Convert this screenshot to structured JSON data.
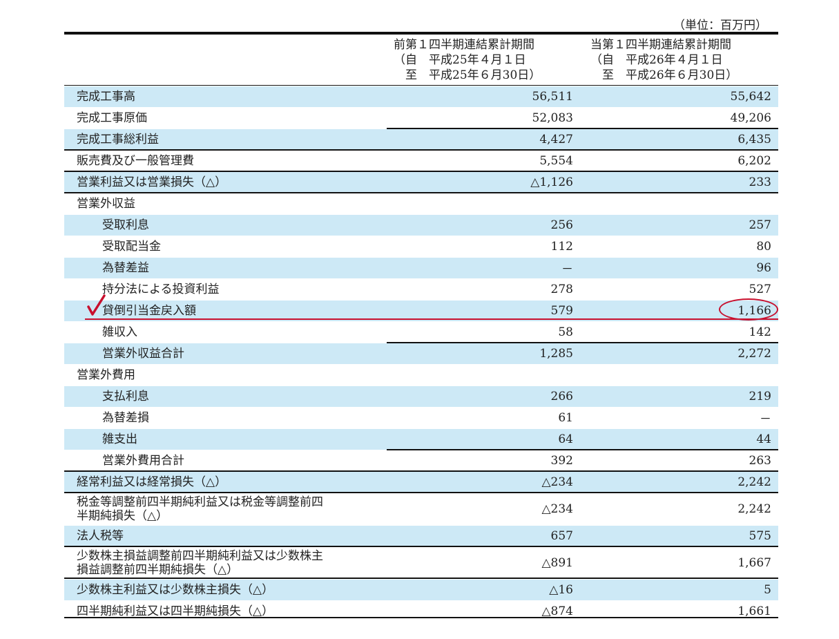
{
  "unit_label": "（単位：百万円）",
  "columns": {
    "prev": "前第１四半期連結累計期間\n（自　平成25年４月１日\n　至　平成25年６月30日）",
    "curr": "当第１四半期連結累計期間\n（自　平成26年４月１日\n　至　平成26年６月30日）"
  },
  "rows": [
    {
      "label": "完成工事高",
      "prev": "56,511",
      "curr": "55,642"
    },
    {
      "label": "完成工事原価",
      "prev": "52,083",
      "curr": "49,206"
    },
    {
      "label": "完成工事総利益",
      "prev": "4,427",
      "curr": "6,435"
    },
    {
      "label": "販売費及び一般管理費",
      "prev": "5,554",
      "curr": "6,202"
    },
    {
      "label": "営業利益又は営業損失（△）",
      "prev": "△1,126",
      "curr": "233"
    },
    {
      "label": "営業外収益",
      "prev": "",
      "curr": ""
    },
    {
      "label": "受取利息",
      "prev": "256",
      "curr": "257"
    },
    {
      "label": "受取配当金",
      "prev": "112",
      "curr": "80"
    },
    {
      "label": "為替差益",
      "prev": "－",
      "curr": "96"
    },
    {
      "label": "持分法による投資利益",
      "prev": "278",
      "curr": "527"
    },
    {
      "label": "貸倒引当金戻入額",
      "prev": "579",
      "curr": "1,166"
    },
    {
      "label": "雑収入",
      "prev": "58",
      "curr": "142"
    },
    {
      "label": "営業外収益合計",
      "prev": "1,285",
      "curr": "2,272"
    },
    {
      "label": "営業外費用",
      "prev": "",
      "curr": ""
    },
    {
      "label": "支払利息",
      "prev": "266",
      "curr": "219"
    },
    {
      "label": "為替差損",
      "prev": "61",
      "curr": "－"
    },
    {
      "label": "雑支出",
      "prev": "64",
      "curr": "44"
    },
    {
      "label": "営業外費用合計",
      "prev": "392",
      "curr": "263"
    },
    {
      "label": "経常利益又は経常損失（△）",
      "prev": "△234",
      "curr": "2,242"
    },
    {
      "label": "税金等調整前四半期純利益又は税金等調整前四\n半期純損失（△）",
      "prev": "△234",
      "curr": "2,242"
    },
    {
      "label": "法人税等",
      "prev": "657",
      "curr": "575"
    },
    {
      "label": "少数株主損益調整前四半期純利益又は少数株主\n損益調整前四半期純損失（△）",
      "prev": "△891",
      "curr": "1,667"
    },
    {
      "label": "少数株主利益又は少数株主損失（△）",
      "prev": "△16",
      "curr": "5"
    },
    {
      "label": "四半期純利益又は四半期純損失（△）",
      "prev": "△874",
      "curr": "1,661"
    }
  ],
  "highlight_color": "#c8102e"
}
